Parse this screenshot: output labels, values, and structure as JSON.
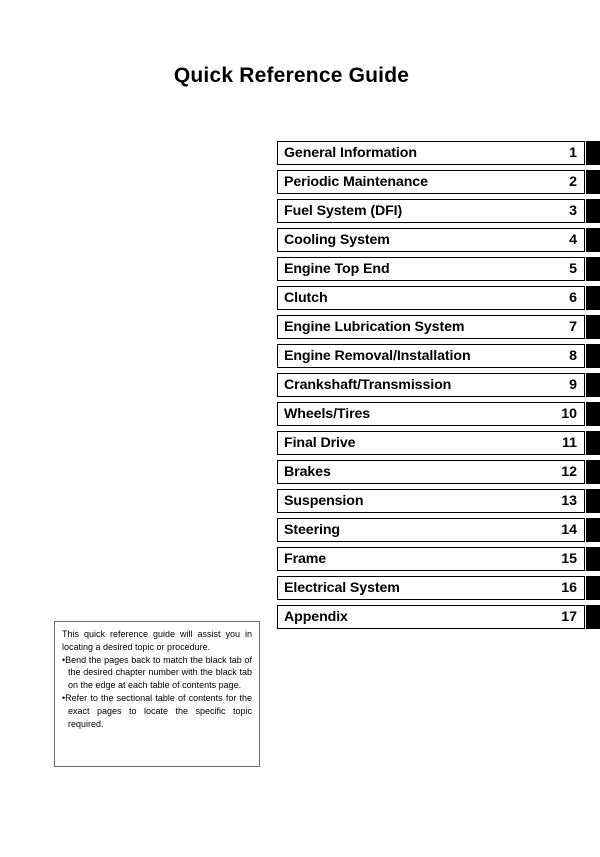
{
  "document": {
    "title": "Quick Reference Guide"
  },
  "chapters": [
    {
      "label": "General Information",
      "number": "1"
    },
    {
      "label": "Periodic Maintenance",
      "number": "2"
    },
    {
      "label": "Fuel System (DFI)",
      "number": "3"
    },
    {
      "label": "Cooling System",
      "number": "4"
    },
    {
      "label": "Engine Top End",
      "number": "5"
    },
    {
      "label": "Clutch",
      "number": "6"
    },
    {
      "label": "Engine Lubrication System",
      "number": "7"
    },
    {
      "label": "Engine Removal/Installation",
      "number": "8"
    },
    {
      "label": "Crankshaft/Transmission",
      "number": "9"
    },
    {
      "label": "Wheels/Tires",
      "number": "10"
    },
    {
      "label": "Final Drive",
      "number": "11"
    },
    {
      "label": "Brakes",
      "number": "12"
    },
    {
      "label": "Suspension",
      "number": "13"
    },
    {
      "label": "Steering",
      "number": "14"
    },
    {
      "label": "Frame",
      "number": "15"
    },
    {
      "label": "Electrical System",
      "number": "16"
    },
    {
      "label": "Appendix",
      "number": "17"
    }
  ],
  "note": {
    "intro": "This quick reference guide will assist you in locating a desired topic or procedure.",
    "bullets": [
      "•Bend the pages back to match the black tab of the desired chapter number with the black tab on the edge at each table of contents page.",
      "•Refer to the sectional table of contents for the exact pages to locate the specific topic required."
    ]
  },
  "colors": {
    "tab": "#000000",
    "box_border": "#000000",
    "note_border": "#6e6e6e",
    "page_background": "#ffffff"
  }
}
